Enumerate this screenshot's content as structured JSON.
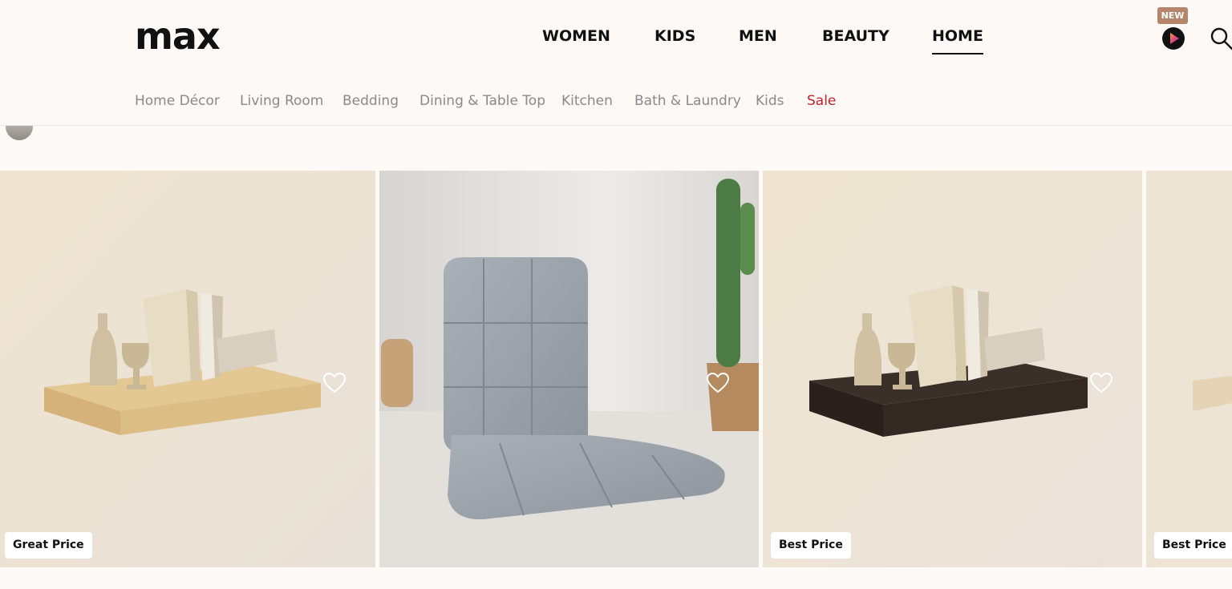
{
  "header": {
    "logo": "max",
    "nav": [
      {
        "label": "WOMEN",
        "active": false
      },
      {
        "label": "KIDS",
        "active": false
      },
      {
        "label": "MEN",
        "active": false
      },
      {
        "label": "BEAUTY",
        "active": false
      },
      {
        "label": "HOME",
        "active": true
      }
    ],
    "new_badge": "NEW",
    "play_icon": "play-icon",
    "search_icon": "search-icon"
  },
  "subnav": [
    {
      "label": "Home Décor"
    },
    {
      "label": "Living Room"
    },
    {
      "label": "Bedding"
    },
    {
      "label": "Dining & Table Top"
    },
    {
      "label": "Kitchen"
    },
    {
      "label": "Bath & Laundry"
    },
    {
      "label": "Kids"
    },
    {
      "label": "Sale",
      "highlight": "#c4222c"
    }
  ],
  "products": [
    {
      "badge": "Great Price",
      "image": "wooden-shelf-with-vases-and-books",
      "favorite_icon": "heart-icon"
    },
    {
      "badge": "",
      "image": "grey-floor-chair",
      "favorite_icon": "heart-icon"
    },
    {
      "badge": "Best Price",
      "image": "dark-shelf-with-vases-and-books",
      "favorite_icon": "heart-icon"
    },
    {
      "badge": "Best Price",
      "image": "shelf-partial",
      "favorite_icon": "heart-icon"
    }
  ],
  "colors": {
    "background": "#fcf9f6",
    "sale": "#c4222c",
    "new_badge": "#b4856a"
  }
}
